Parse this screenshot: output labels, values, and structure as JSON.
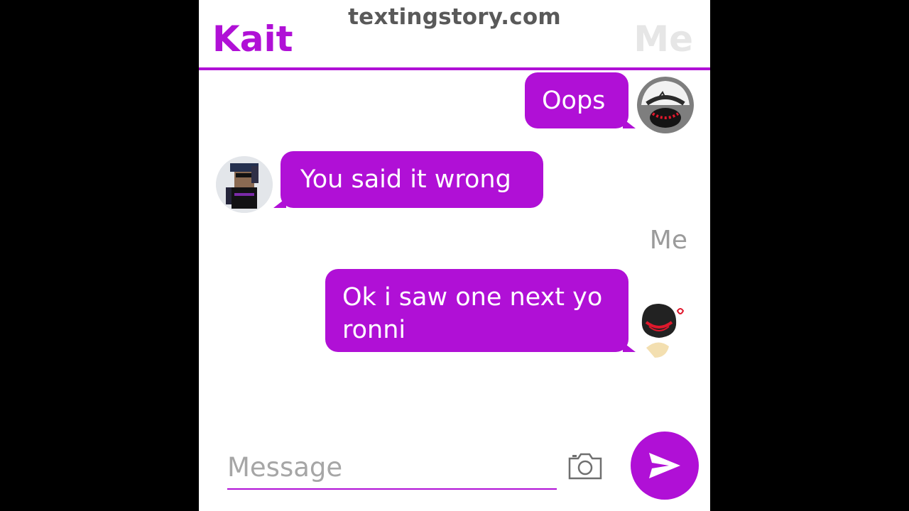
{
  "watermark": "textingstory.com",
  "header": {
    "contact_name": "Kait",
    "me_label": "Me"
  },
  "messages": [
    {
      "sender": "me",
      "text": "Oops",
      "avatar": "avatar-me-ball-icon"
    },
    {
      "sender": "contact",
      "text": "You said it wrong",
      "avatar": "avatar-contact-roblox-icon"
    },
    {
      "sender": "me",
      "sender_label": "Me",
      "text": "Ok i saw one next yo ronni",
      "avatar": "avatar-me-sketch-icon"
    }
  ],
  "composer": {
    "placeholder": "Message",
    "camera_icon": "camera-icon",
    "send_icon": "send-icon"
  },
  "colors": {
    "accent": "#b010d6",
    "bubble_text": "#ffffff",
    "muted": "#9b9b9b"
  }
}
